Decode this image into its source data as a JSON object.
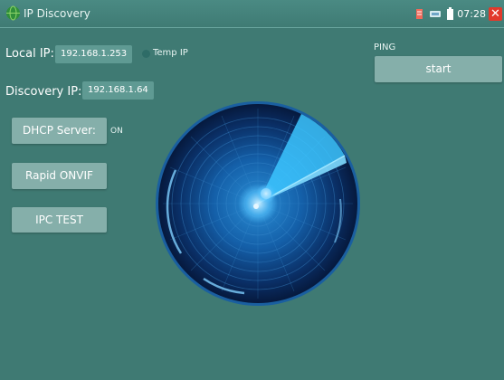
{
  "window": {
    "title": "IP Discovery",
    "time": "07:28",
    "icons": [
      "app-globe-icon",
      "battery-warning-icon",
      "network-icon",
      "battery-icon",
      "close-icon"
    ]
  },
  "form": {
    "local_ip_label": "Local IP:",
    "local_ip_value": "192.168.1.253",
    "temp_ip_label": "Temp IP",
    "discovery_ip_label": "Discovery IP:",
    "discovery_ip_value": "192.168.1.64"
  },
  "buttons": {
    "dhcp_label": "DHCP Server:",
    "dhcp_status": "ON",
    "rapid_onvif_label": "Rapid ONVIF",
    "ipc_test_label": "IPC TEST"
  },
  "ping": {
    "label": "PING",
    "start_label": "start"
  },
  "colors": {
    "background": "#3f7a73",
    "radar_accent": "#29b6f6",
    "close": "#e2392b"
  }
}
